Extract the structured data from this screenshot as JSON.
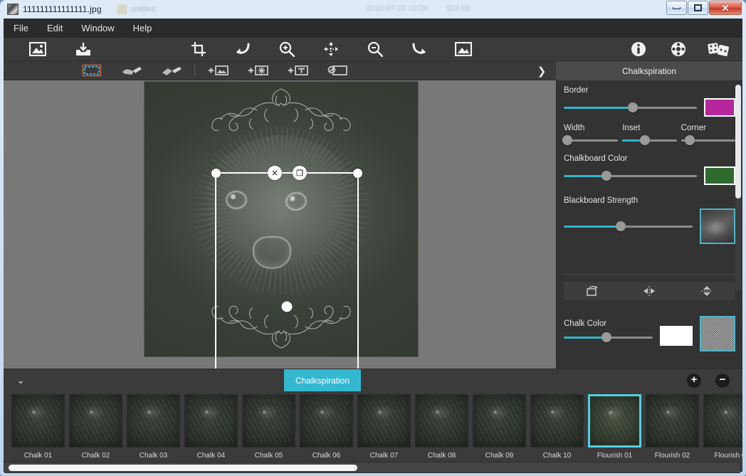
{
  "window": {
    "title": "111111111111111.jpg",
    "ghost_label": "untitled",
    "ghost_meta_1": "2016-07-22 13:24",
    "ghost_meta_2": "524 kB",
    "minimize_label": "Minimize",
    "maximize_label": "Maximize",
    "close_label": "Close"
  },
  "menubar": {
    "items": [
      {
        "label": "File"
      },
      {
        "label": "Edit"
      },
      {
        "label": "Window"
      },
      {
        "label": "Help"
      }
    ]
  },
  "toolbar": {
    "items": [
      {
        "name": "open-image-icon",
        "tooltip": "Open Image"
      },
      {
        "name": "save-image-icon",
        "tooltip": "Save Image"
      },
      {
        "name": "crop-icon",
        "tooltip": "Crop"
      },
      {
        "name": "undo-icon",
        "tooltip": "Undo"
      },
      {
        "name": "zoom-in-icon",
        "tooltip": "Zoom In"
      },
      {
        "name": "move-icon",
        "tooltip": "Pan"
      },
      {
        "name": "zoom-out-icon",
        "tooltip": "Zoom Out"
      },
      {
        "name": "redo-icon",
        "tooltip": "Redo"
      },
      {
        "name": "fit-image-icon",
        "tooltip": "Fit to Screen"
      },
      {
        "name": "info-icon",
        "tooltip": "Info"
      },
      {
        "name": "settings-icon",
        "tooltip": "Settings"
      },
      {
        "name": "random-icon",
        "tooltip": "Randomize"
      }
    ]
  },
  "subtoolbar": {
    "items": [
      {
        "name": "select-tool-icon",
        "label": "Select",
        "active": true
      },
      {
        "name": "brush-tool-icon",
        "label": "Brush",
        "active": false
      },
      {
        "name": "eraser-tool-icon",
        "label": "Eraser",
        "active": false
      },
      {
        "name": "add-image-icon",
        "label": "Add Image",
        "active": false
      },
      {
        "name": "add-effect-icon",
        "label": "Add Effect",
        "active": false
      },
      {
        "name": "add-text-icon",
        "label": "Add Text",
        "active": false
      },
      {
        "name": "clear-layer-icon",
        "label": "Clear Layer",
        "active": false
      }
    ],
    "expand_icon": "chevron-right-icon",
    "panel_title": "Chalkspiration"
  },
  "canvas": {
    "selection": {
      "delete_glyph": "✕",
      "duplicate_glyph": "❐"
    }
  },
  "panel": {
    "sections": [
      {
        "label": "Border",
        "slider_pct": 52,
        "swatch_color": "#b5279b",
        "swatch_name": "border-color-swatch"
      },
      {
        "label": "Chalkboard Color",
        "slider_pct": 32,
        "swatch_color": "#2d6b2d",
        "swatch_name": "chalkboard-color-swatch"
      },
      {
        "label": "Blackboard Strength",
        "slider_pct": 44,
        "thumb_name": "blackboard-texture-thumbnail"
      }
    ],
    "mini_sliders": [
      {
        "label": "Width",
        "pct": 4
      },
      {
        "label": "Inset",
        "pct": 42
      },
      {
        "label": "Corner",
        "pct": 16
      }
    ],
    "transform_buttons": [
      {
        "name": "rotate-icon",
        "label": "Rotate"
      },
      {
        "name": "flip-horizontal-icon",
        "label": "Flip Horizontal"
      },
      {
        "name": "flip-vertical-icon",
        "label": "Flip Vertical"
      }
    ],
    "chalk_color": {
      "label": "Chalk Color",
      "slider_pct": 48,
      "swatch_color": "#ffffff",
      "thumb_name": "chalk-texture-thumbnail"
    },
    "accent_color": "#2fb5c9"
  },
  "filmstrip": {
    "collapse_icon": "chevron-down-icon",
    "active_tab": "Chalkspiration",
    "add_label": "+",
    "remove_label": "−",
    "thumbnails": [
      {
        "label": "Chalk 01",
        "selected": false
      },
      {
        "label": "Chalk 02",
        "selected": false
      },
      {
        "label": "Chalk 03",
        "selected": false
      },
      {
        "label": "Chalk 04",
        "selected": false
      },
      {
        "label": "Chalk 05",
        "selected": false
      },
      {
        "label": "Chalk 06",
        "selected": false
      },
      {
        "label": "Chalk 07",
        "selected": false
      },
      {
        "label": "Chalk 08",
        "selected": false
      },
      {
        "label": "Chalk 09",
        "selected": false
      },
      {
        "label": "Chalk 10",
        "selected": false
      },
      {
        "label": "Flourish 01",
        "selected": true
      },
      {
        "label": "Flourish 02",
        "selected": false
      },
      {
        "label": "Flourish 0",
        "selected": false
      }
    ]
  }
}
